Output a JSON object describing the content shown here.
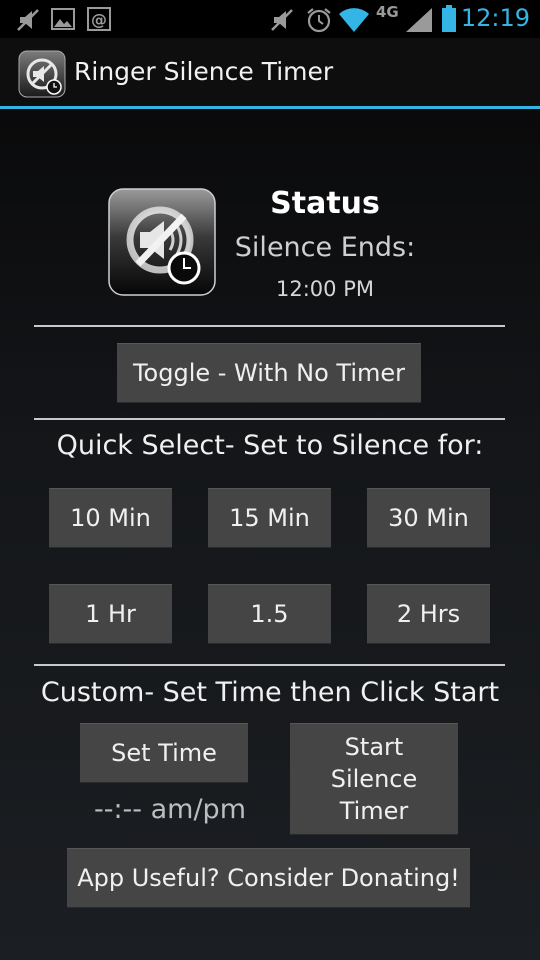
{
  "status_bar": {
    "time": "12:19",
    "network_label": "4G",
    "icons": [
      "mute-icon",
      "image-icon",
      "email-icon",
      "mute-icon",
      "alarm-icon",
      "wifi-icon",
      "cell-signal-icon",
      "battery-icon"
    ]
  },
  "action_bar": {
    "title": "Ringer Silence Timer",
    "accent_color": "#33b5e5"
  },
  "status": {
    "title": "Status",
    "subtitle": "Silence Ends:",
    "end_time": "12:00 PM"
  },
  "toggle_button": "Toggle - With No Timer",
  "quick_select": {
    "label": "Quick Select- Set to Silence for:",
    "buttons": [
      "10 Min",
      "15 Min",
      "30 Min",
      "1 Hr",
      "1.5",
      "2 Hrs"
    ]
  },
  "custom": {
    "label": "Custom- Set Time then Click Start",
    "set_time_button": "Set Time",
    "time_placeholder": "--:-- am/pm",
    "start_button_lines": [
      "Start",
      "Silence",
      "Timer"
    ]
  },
  "donate_button": "App Useful? Consider Donating!"
}
